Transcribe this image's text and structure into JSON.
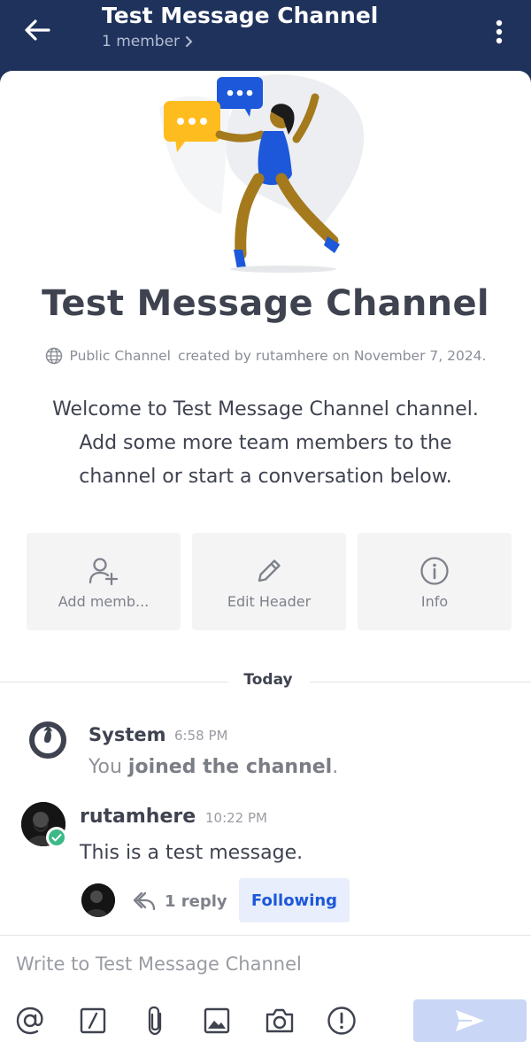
{
  "header": {
    "title": "Test Message Channel",
    "subtitle": "1 member",
    "background": "#1e325c"
  },
  "intro": {
    "title": "Test Message Channel",
    "channel_type": "Public Channel",
    "created_by": "created by rutamhere on November 7, 2024.",
    "welcome_line1": "Welcome to Test Message Channel channel.",
    "welcome_line2": "Add some more team members to the",
    "welcome_line3": "channel or start a conversation below."
  },
  "actions": [
    {
      "label": "Add memb...",
      "icon": "add-member-icon"
    },
    {
      "label": "Edit Header",
      "icon": "pencil-icon"
    },
    {
      "label": "Info",
      "icon": "info-icon"
    }
  ],
  "date_separator": "Today",
  "messages": [
    {
      "author": "System",
      "time": "6:58 PM",
      "text_plain": "You ",
      "text_bold": "joined the channel",
      "text_end": "."
    },
    {
      "author": "rutamhere",
      "time": "10:22 PM",
      "text": "This is a test message.",
      "replies": "1 reply",
      "follow_label": "Following"
    }
  ],
  "composer": {
    "placeholder": "Write to Test Message Channel",
    "tools": [
      "at-icon",
      "slash-icon",
      "paperclip-icon",
      "image-icon",
      "camera-icon",
      "priority-icon"
    ],
    "send_icon": "send-icon"
  },
  "colors": {
    "accent": "#1c58d9",
    "online": "#3db887",
    "send_disabled": "#c9d6f5"
  }
}
